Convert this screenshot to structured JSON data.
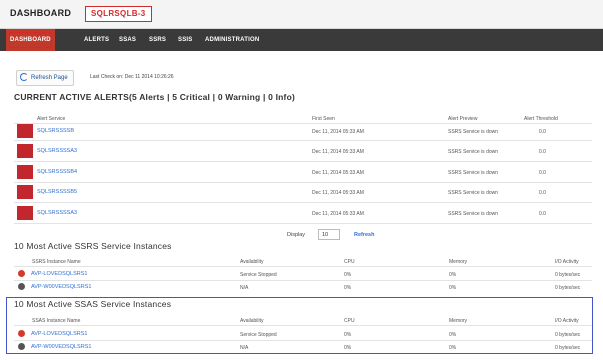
{
  "header": {
    "brand": "DASHBOARD",
    "instance": "SQLRSQLB-3"
  },
  "nav": [
    {
      "label": "DASHBOARD",
      "active": true
    },
    {
      "label": "ALERTS"
    },
    {
      "label": "SSAS"
    },
    {
      "label": "SSRS"
    },
    {
      "label": "SSIS"
    },
    {
      "label": "ADMINISTRATION"
    }
  ],
  "toolbar": {
    "refresh_label": "Refresh Page",
    "last_check": "Last Check on: Dec 11 2014 10:26:26"
  },
  "alerts": {
    "title": "CURRENT ACTIVE ALERTS(5 Alerts | 5 Critical | 0 Warning | 0 Info)",
    "columns": [
      "Alert Service",
      "First Seen",
      "Alert Preview",
      "Alert Threshold"
    ],
    "rows": [
      {
        "service": "SQLSRSSSSB",
        "first_seen": "Dec 11, 2014 05:33 AM",
        "preview": "SSRS Service is down",
        "threshold": "0.0"
      },
      {
        "service": "SQLSRSSSSA3",
        "first_seen": "Dec 11, 2014 05:33 AM",
        "preview": "SSRS Service is down",
        "threshold": "0.0"
      },
      {
        "service": "SQLSRSSSSB4",
        "first_seen": "Dec 11, 2014 05:33 AM",
        "preview": "SSRS Service is down",
        "threshold": "0.0"
      },
      {
        "service": "SQLSRSSSSB5",
        "first_seen": "Dec 11, 2014 05:33 AM",
        "preview": "SSRS Service is down",
        "threshold": "0.0"
      },
      {
        "service": "SQLSRSSSSA3",
        "first_seen": "Dec 11, 2014 05:33 AM",
        "preview": "SSRS Service is down",
        "threshold": "0.0"
      }
    ]
  },
  "display": {
    "label": "Display",
    "value": "10",
    "refresh_label": "Refresh"
  },
  "ssrs_section": {
    "title": "10 Most Active SSRS Service Instances",
    "columns": [
      "SSRS Instance Name",
      "Availability",
      "CPU",
      "Memory",
      "I/O Activity"
    ],
    "rows": [
      {
        "status_color": "#d33a2c",
        "name": "AVP-LOVEDSQLSRS1",
        "availability": "Service Stopped",
        "cpu": "0%",
        "memory": "0%",
        "io": "0 bytes/sec"
      },
      {
        "status_color": "#555555",
        "name": "AVP-W00VEDSQLSRS1",
        "availability": "N/A",
        "cpu": "0%",
        "memory": "0%",
        "io": "0 bytes/sec"
      }
    ]
  },
  "ssas_section": {
    "title": "10 Most Active SSAS Service Instances",
    "columns": [
      "SSAS Instance Name",
      "Availability",
      "CPU",
      "Memory",
      "I/O Activity"
    ],
    "rows": [
      {
        "status_color": "#d33a2c",
        "name": "AVP-LOVEDSQLSRS1",
        "availability": "Service Stopped",
        "cpu": "0%",
        "memory": "0%",
        "io": "0 bytes/sec"
      },
      {
        "status_color": "#555555",
        "name": "AVP-W00VEDSQLSRS1",
        "availability": "N/A",
        "cpu": "0%",
        "memory": "0%",
        "io": "0 bytes/sec"
      }
    ]
  }
}
